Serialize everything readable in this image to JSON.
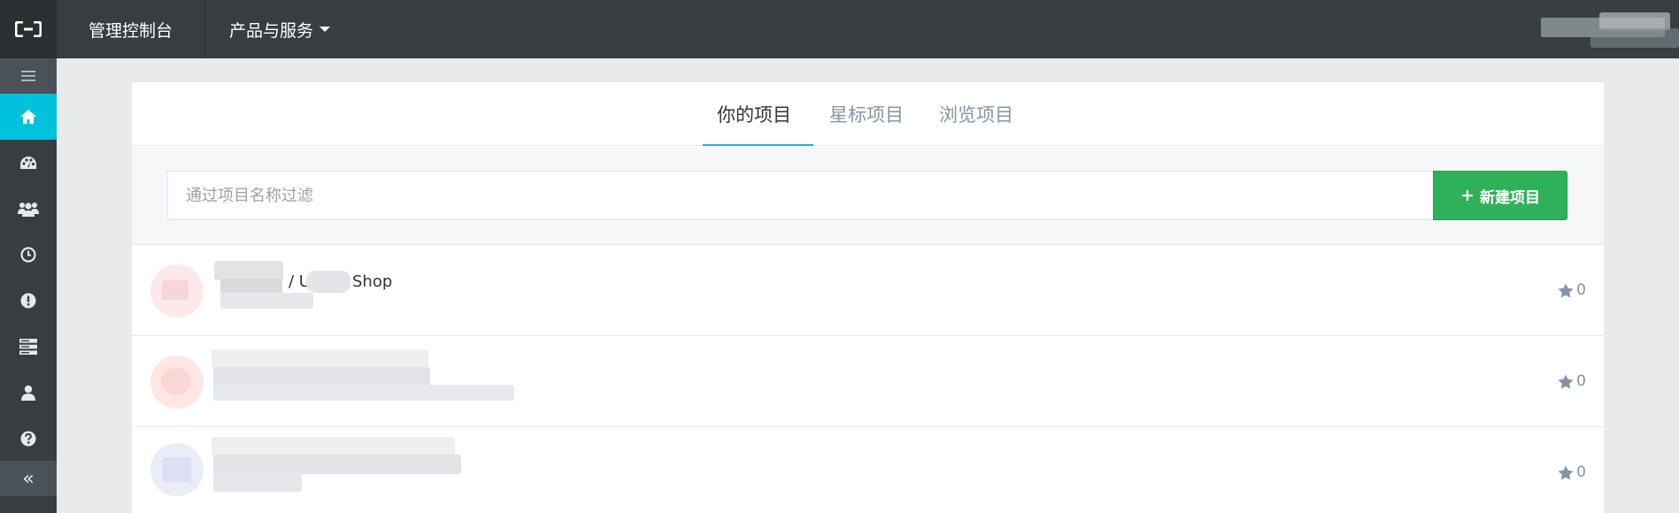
{
  "topbar": {
    "console_label": "管理控制台",
    "products_label": "产品与服务"
  },
  "sidebar": {
    "items": [
      {
        "name": "home",
        "icon": "home-icon",
        "active": true
      },
      {
        "name": "dashboard",
        "icon": "dashboard-icon",
        "active": false
      },
      {
        "name": "team",
        "icon": "users-icon",
        "active": false
      },
      {
        "name": "history",
        "icon": "clock-icon",
        "active": false
      },
      {
        "name": "alerts",
        "icon": "exclamation-icon",
        "active": false
      },
      {
        "name": "servers",
        "icon": "server-icon",
        "active": false
      },
      {
        "name": "account",
        "icon": "user-icon",
        "active": false
      },
      {
        "name": "help",
        "icon": "question-icon",
        "active": false
      }
    ],
    "collapse_label": "«"
  },
  "tabs": [
    {
      "label": "你的项目",
      "active": true
    },
    {
      "label": "星标项目",
      "active": false
    },
    {
      "label": "浏览项目",
      "active": false
    }
  ],
  "filter": {
    "placeholder": "通过项目名称过滤",
    "new_project_label": "新建项目",
    "new_project_icon": "+"
  },
  "projects": [
    {
      "name_suffix": "/ U",
      "name_end": "Shop",
      "stars": "0",
      "avatar_color": "#fde9ea"
    },
    {
      "stars": "0",
      "avatar_color": "#fde6e4"
    },
    {
      "stars": "0",
      "avatar_color": "#eaecf8"
    }
  ],
  "colors": {
    "topbar_bg": "#373d41",
    "active_nav": "#00c1de",
    "primary_button": "#2fb15a",
    "tab_underline": "#2aa6e0"
  }
}
